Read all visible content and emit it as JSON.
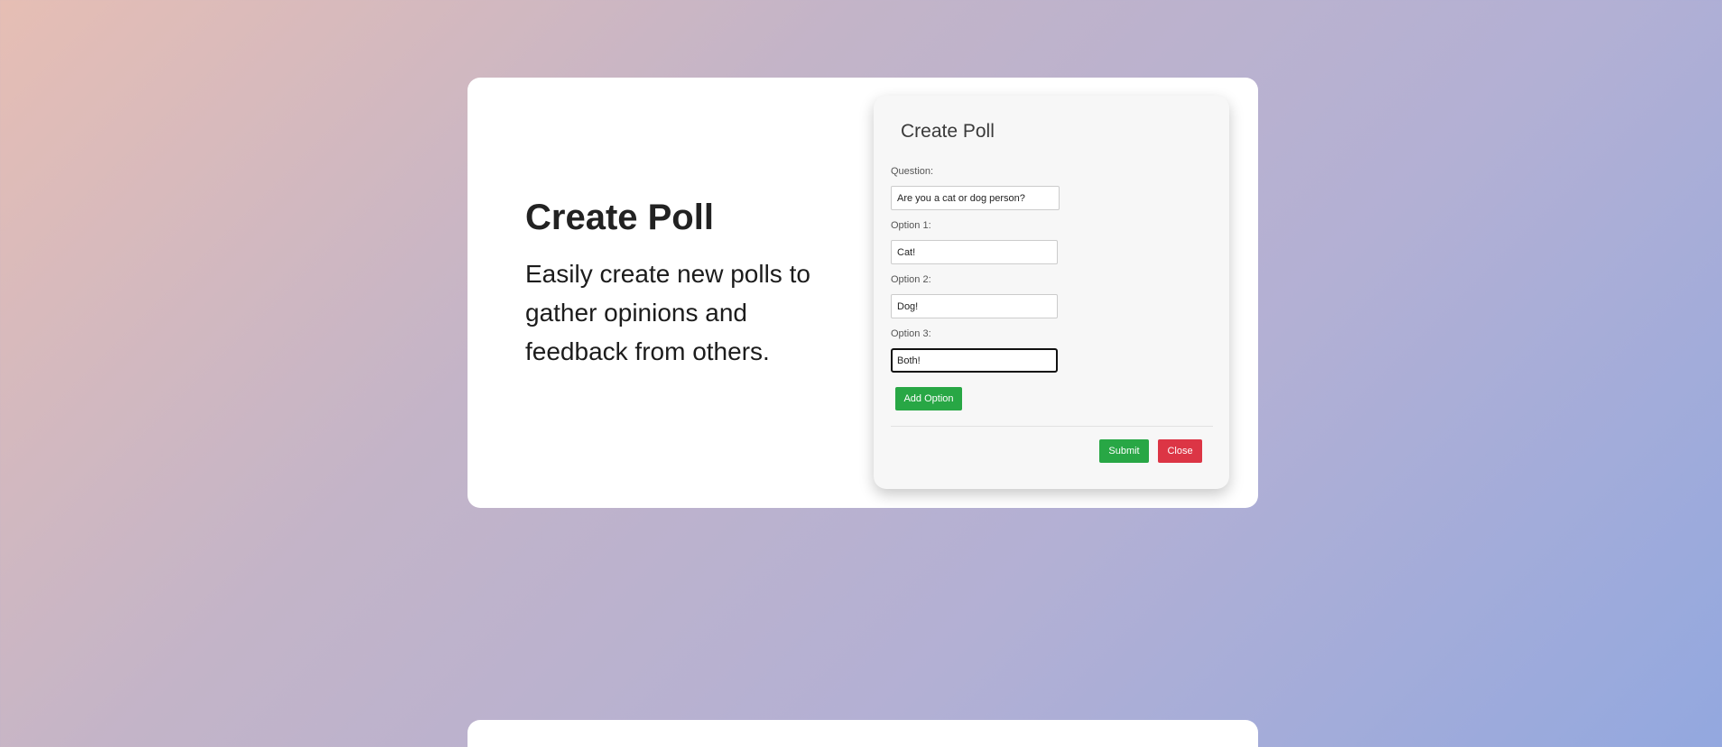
{
  "intro": {
    "title": "Create Poll",
    "description": "Easily create new polls to gather opinions and feedback from others."
  },
  "modal": {
    "title": "Create Poll",
    "fields": [
      {
        "label": "Question:",
        "value": "Are you a cat or dog person?"
      },
      {
        "label": "Option 1:",
        "value": "Cat!"
      },
      {
        "label": "Option 2:",
        "value": "Dog!"
      },
      {
        "label": "Option 3:",
        "value": "Both!"
      }
    ],
    "add_option_label": "Add Option",
    "submit_label": "Submit",
    "close_label": "Close"
  },
  "colors": {
    "success": "#28a745",
    "danger": "#dc3545"
  }
}
